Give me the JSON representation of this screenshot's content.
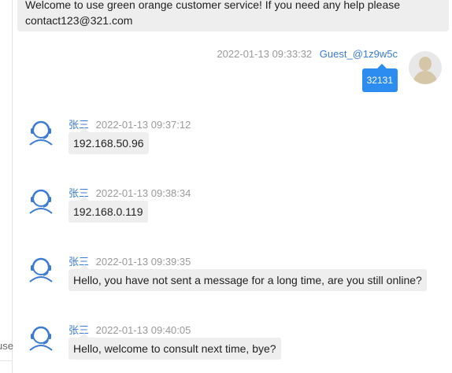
{
  "welcome_banner": {
    "text": "Welcome to use green orange customer service! If you need any help please contact123@321.com"
  },
  "left_panel": {
    "fragment_text": "use"
  },
  "guest_message": {
    "timestamp": "2022-01-13 09:33:32",
    "sender": "Guest_@1z9w5c",
    "text": "32131",
    "avatar_icon": "user-avatar-icon"
  },
  "agent_messages": [
    {
      "sender": "张三",
      "timestamp": "2022-01-13 09:37:12",
      "text": "192.168.50.96",
      "avatar_icon": "headset-agent-icon"
    },
    {
      "sender": "张三",
      "timestamp": "2022-01-13 09:38:34",
      "text": "192.168.0.119",
      "avatar_icon": "headset-agent-icon"
    },
    {
      "sender": "张三",
      "timestamp": "2022-01-13 09:39:35",
      "text": "Hello, you have not sent a message for a long time, are you still online?",
      "avatar_icon": "headset-agent-icon"
    },
    {
      "sender": "张三",
      "timestamp": "2022-01-13 09:40:05",
      "text": "Hello, welcome to consult next time, bye?",
      "avatar_icon": "headset-agent-icon"
    }
  ],
  "colors": {
    "accent_blue": "#2d8cf0",
    "name_blue": "#3a7bd5",
    "bubble_gray": "#eeeeee",
    "timestamp_gray": "#9a9a9a"
  }
}
